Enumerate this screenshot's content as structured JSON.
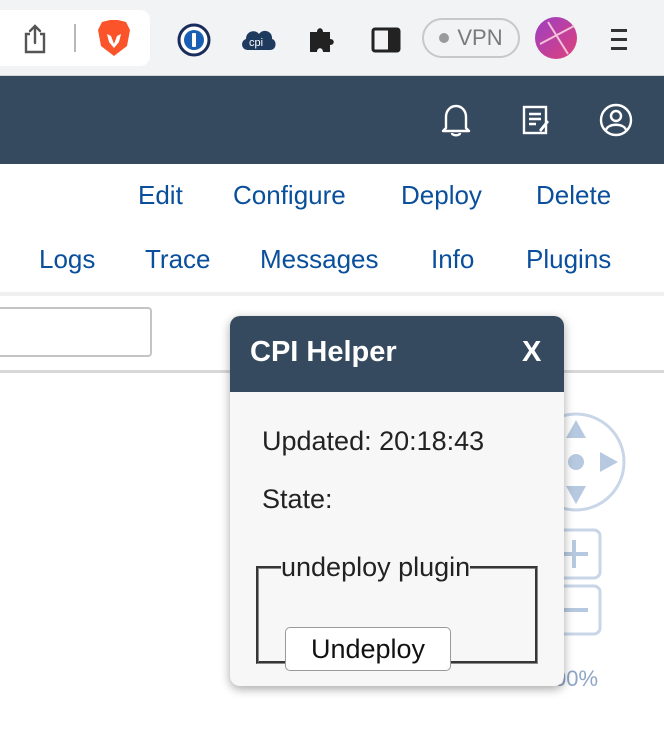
{
  "browser": {
    "vpn_label": "VPN",
    "extensions": [
      "share-icon",
      "brave-icon",
      "onepassword-icon",
      "cpi-helper-icon",
      "puzzle-icon",
      "sidebar-icon"
    ],
    "cpi_icon_text": "cpi"
  },
  "shell": {
    "header_color": "#354a5f",
    "icons": [
      "bell-icon",
      "notes-icon",
      "user-icon"
    ]
  },
  "actions": {
    "edit": "Edit",
    "configure": "Configure",
    "deploy": "Deploy",
    "delete": "Delete",
    "logs": "Logs",
    "trace": "Trace",
    "messages": "Messages",
    "info": "Info",
    "plugins": "Plugins"
  },
  "canvas": {
    "zoom_level_visible": "00%"
  },
  "popup": {
    "title": "CPI Helper",
    "close_label": "X",
    "updated": "Updated: 20:18:43",
    "state": "State:",
    "plugin_legend": "undeploy plugin",
    "undeploy_button": "Undeploy"
  },
  "colors": {
    "link": "#0a4f9c",
    "brand_header": "#354a5f"
  }
}
